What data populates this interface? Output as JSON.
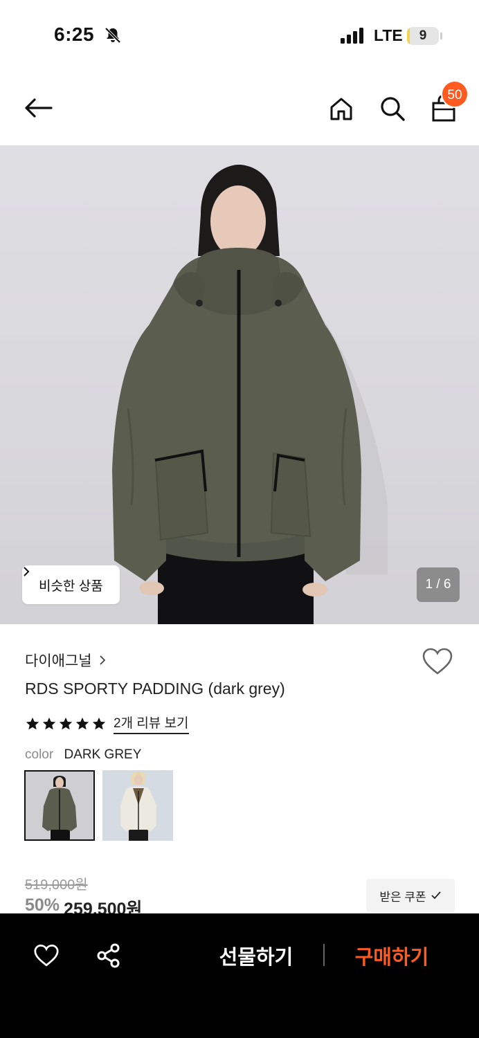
{
  "status_bar": {
    "time": "6:25",
    "network": "LTE",
    "battery": "9",
    "battery_level": 0.09
  },
  "nav": {
    "cart_count": "50",
    "icons": [
      "back-arrow-icon",
      "home-icon",
      "search-icon",
      "shopping-bag-icon"
    ]
  },
  "hero": {
    "similar_label": "비슷한 상품",
    "pager": "1 / 6"
  },
  "product": {
    "brand": "다이애그널",
    "name": "RDS SPORTY PADDING (dark grey)",
    "review_link": "2개 리뷰 보기",
    "rating_stars": 5,
    "color_key": "color",
    "color_value": "DARK GREY",
    "original_price": "519,000원",
    "discount": "50%",
    "price": "259,500원",
    "coupon_label": "받은 쿠폰"
  },
  "bottom_bar": {
    "gift_label": "선물하기",
    "buy_label": "구매하기"
  },
  "colors": {
    "accent": "#ff5a1f",
    "bottom_bar_bg": "#000000",
    "jacket_khaki": "#5b5e4f"
  }
}
